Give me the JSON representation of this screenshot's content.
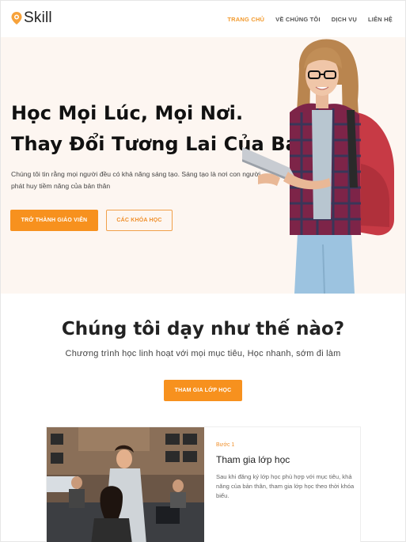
{
  "header": {
    "logo_text": "Skill",
    "nav": [
      {
        "label": "TRANG CHỦ",
        "active": true
      },
      {
        "label": "VỀ CHÚNG TÔI",
        "active": false
      },
      {
        "label": "DỊCH VỤ",
        "active": false
      },
      {
        "label": "LIÊN HỆ",
        "active": false
      }
    ]
  },
  "hero": {
    "title_line1": "Học Mọi Lúc, Mọi Nơi.",
    "title_line2": "Thay Đổi Tương Lai Của Bạn.",
    "description": "Chúng tôi tin rằng mọi người đều có khả năng sáng tạo. Sáng tạo là nơi con người phát huy tiềm năng của bản thân",
    "primary_button": "TRỞ THÀNH GIÁO VIÊN",
    "secondary_button": "CÁC KHÓA HỌC"
  },
  "how": {
    "title": "Chúng tôi dạy như thế nào?",
    "subtitle": "Chương trình học linh hoạt với mọi mục tiêu, Học nhanh, sớm đi làm",
    "button": "THAM GIA LỚP HỌC"
  },
  "card": {
    "step": "Bước 1",
    "title": "Tham gia lớp học",
    "text": "Sau khi đăng ký lớp học phù hợp với mục tiêu, khả năng của bản thân, tham gia lớp học theo thời khóa biểu."
  },
  "colors": {
    "accent": "#f7911e",
    "hero_bg": "#fdf6f1"
  }
}
